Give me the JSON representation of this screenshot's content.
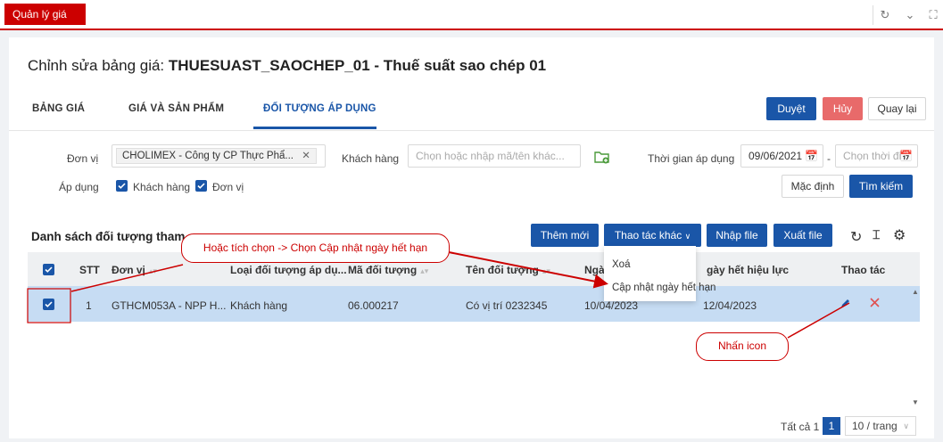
{
  "app_tab": "Quản lý giá",
  "title_prefix": "Chỉnh sửa bảng giá: ",
  "title_code": "THUESUAST_SAOCHEP_01 - Thuế suất sao chép 01",
  "tabs": [
    "BẢNG GIÁ",
    "GIÁ VÀ SẢN PHẨM",
    "ĐỐI TƯỢNG ÁP DỤNG"
  ],
  "header_buttons": {
    "approve": "Duyệt",
    "cancel": "Hủy",
    "back": "Quay lại"
  },
  "filters": {
    "unit_label": "Đơn vị",
    "unit_value": "CHOLIMEX - Công ty CP Thực Phẩ...",
    "customer_label": "Khách hàng",
    "customer_placeholder": "Chọn hoặc nhập mã/tên khác...",
    "time_label": "Thời gian áp dụng",
    "date_from": "09/06/2021",
    "date_to_placeholder": "Chọn thời đi",
    "apply_label": "Áp dụng",
    "apply_customer": "Khách hàng",
    "apply_unit": "Đơn vị",
    "default_btn": "Mặc định",
    "search_btn": "Tìm kiếm"
  },
  "list": {
    "title": "Danh sách đối tượng tham g",
    "add_btn": "Thêm mới",
    "other_btn": "Thao tác khác",
    "import_btn": "Nhập file",
    "export_btn": "Xuất file"
  },
  "dropdown": {
    "items": [
      "Xoá",
      "Cập nhật ngày hết hạn"
    ]
  },
  "columns": [
    "STT",
    "Đơn vị",
    "Loại đối tượng áp dụ...",
    "Mã đối tượng",
    "Tên đối tượng",
    "Ngà",
    "gày hết hiệu lực",
    "Thao tác"
  ],
  "rows": [
    {
      "stt": "1",
      "unit": "GTHCM053A - NPP H...",
      "type": "Khách hàng",
      "code": "06.000217",
      "name": "Có vị trí 0232345",
      "start": "10/04/2023",
      "end": "12/04/2023"
    }
  ],
  "pager": {
    "total": "Tất cả 1",
    "page": "1",
    "size": "10 / trang"
  },
  "annotations": {
    "callout1": "Hoặc tích chọn -> Chọn Cập nhật ngày hết hạn",
    "callout2": "Nhấn icon"
  },
  "colors": {
    "brand_red": "#cc0000",
    "primary": "#1a56a8",
    "danger_btn": "#e86a6a",
    "selected_row": "#c6dcf3"
  }
}
